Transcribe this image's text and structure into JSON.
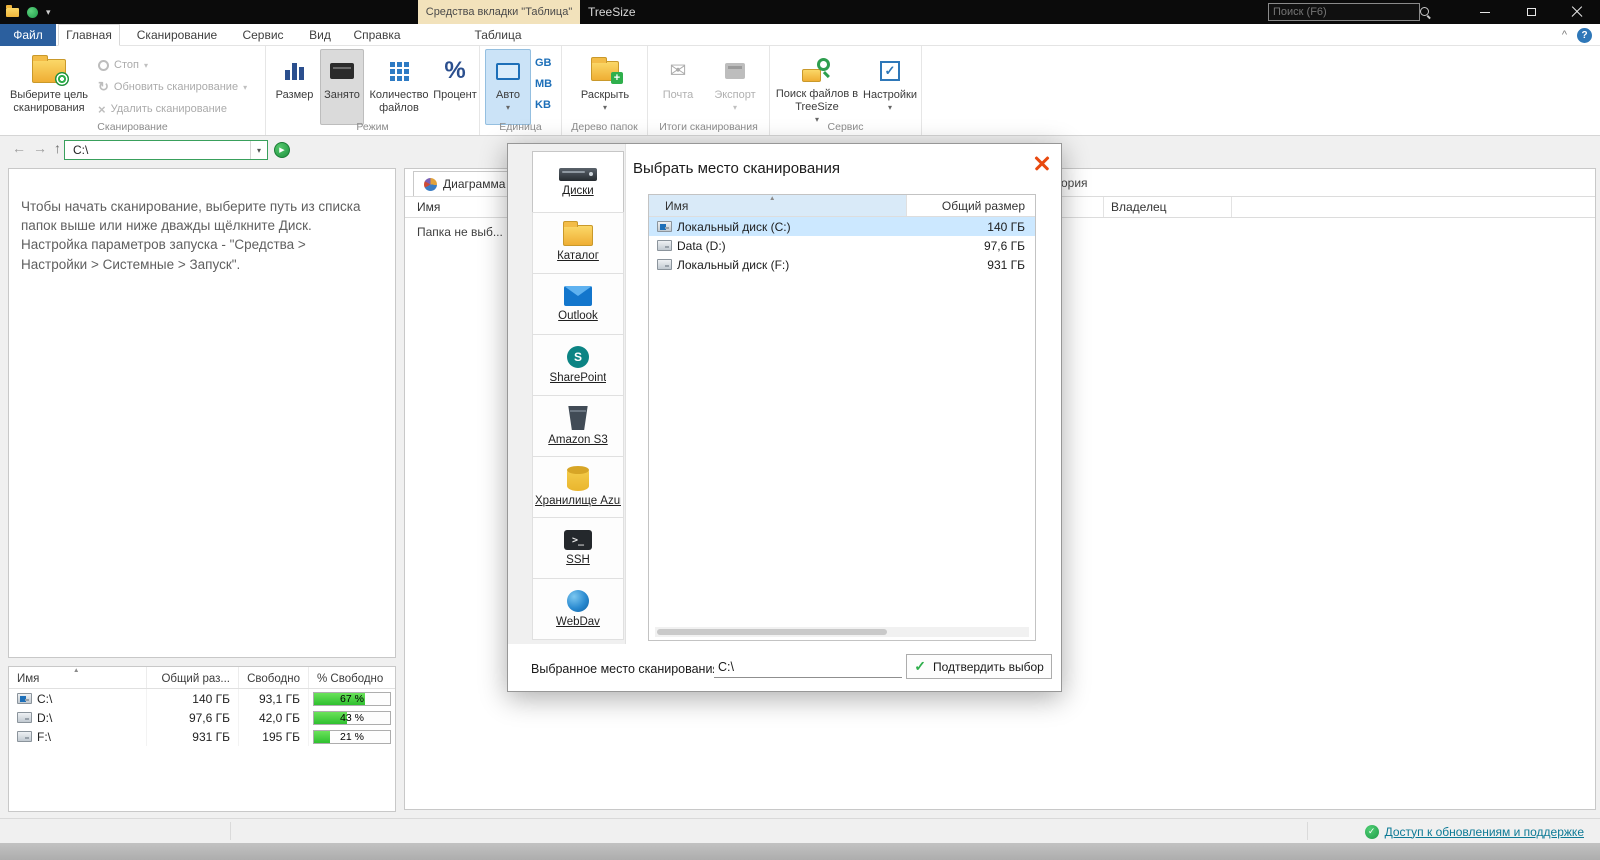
{
  "titlebar": {
    "contextual_header": "Средства вкладки \"Таблица\"",
    "app_title": "TreeSize",
    "search_placeholder": "Поиск (F6)"
  },
  "tabs": {
    "file": "Файл",
    "items": [
      "Главная",
      "Сканирование",
      "Сервис",
      "Вид",
      "Справка"
    ],
    "contextual": "Таблица"
  },
  "ribbon": {
    "scan_group": {
      "label": "Сканирование",
      "select_target": "Выберите цель сканирования",
      "stop": "Стоп",
      "refresh": "Обновить сканирование",
      "delete": "Удалить сканирование"
    },
    "mode_group": {
      "label": "Режим",
      "size": "Размер",
      "allocated": "Занято",
      "file_count": "Количество файлов",
      "percent": "Процент"
    },
    "unit_group": {
      "label": "Единица",
      "auto": "Авто",
      "gb": "GB",
      "mb": "MB",
      "kb": "KB"
    },
    "tree_group": {
      "label": "Дерево папок",
      "expand": "Раскрыть"
    },
    "results_group": {
      "label": "Итоги сканирования",
      "mail": "Почта",
      "export": "Экспорт"
    },
    "service_group": {
      "label": "Сервис",
      "search": "Поиск файлов в TreeSize",
      "options": "Настройки"
    }
  },
  "addressbar": {
    "path": "C:\\"
  },
  "icons": {
    "back": "←",
    "forward": "→",
    "up": "↑",
    "dropdown": "▾",
    "play": "▶",
    "check": "✓",
    "sort_asc": "▲",
    "percent": "%",
    "mail": "✉",
    "refresh": "↻",
    "delete": "×",
    "collapse": "^",
    "help": "?",
    "ssh": ">_",
    "sharepoint": "S",
    "plus": "+"
  },
  "info_panel": {
    "text": "Чтобы начать сканирование, выберите путь из списка\nпапок выше или ниже дважды щёлкните Диск.\nНастройка параметров запуска - \"Средства >\nНастройки > Системные > Запуск\"."
  },
  "drive_table": {
    "headers": [
      "Имя",
      "Общий раз...",
      "Свободно",
      "% Свободно"
    ],
    "rows": [
      {
        "name": "C:\\",
        "total": "140 ГБ",
        "free": "93,1 ГБ",
        "pct_label": "67 %",
        "pct": 67
      },
      {
        "name": "D:\\",
        "total": "97,6 ГБ",
        "free": "42,0 ГБ",
        "pct_label": "43 %",
        "pct": 43
      },
      {
        "name": "F:\\",
        "total": "931 ГБ",
        "free": "195 ГБ",
        "pct_label": "21 %",
        "pct": 21
      }
    ]
  },
  "main": {
    "chart_tab": "Диаграмма",
    "partial_tab": "ория",
    "col_name": "Имя",
    "col_owner": "Владелец",
    "empty_row": "Папка не выб..."
  },
  "dialog": {
    "title": "Выбрать место сканирования",
    "sidebar": [
      {
        "label": "Диски"
      },
      {
        "label": "Каталог"
      },
      {
        "label": "Outlook"
      },
      {
        "label": "SharePoint"
      },
      {
        "label": "Amazon S3"
      },
      {
        "label": "Хранилище Azur..."
      },
      {
        "label": "SSH"
      },
      {
        "label": "WebDav"
      }
    ],
    "list": {
      "col_name": "Имя",
      "col_size": "Общий размер",
      "rows": [
        {
          "name": "Локальный диск (C:)",
          "size": "140 ГБ"
        },
        {
          "name": "Data (D:)",
          "size": "97,6 ГБ"
        },
        {
          "name": "Локальный диск (F:)",
          "size": "931 ГБ"
        }
      ]
    },
    "footer": {
      "label": "Выбранное место сканирования:",
      "value": "C:\\",
      "confirm": "Подтвердить выбор"
    }
  },
  "statusbar": {
    "link": "Доступ к обновлениям и поддержке"
  }
}
